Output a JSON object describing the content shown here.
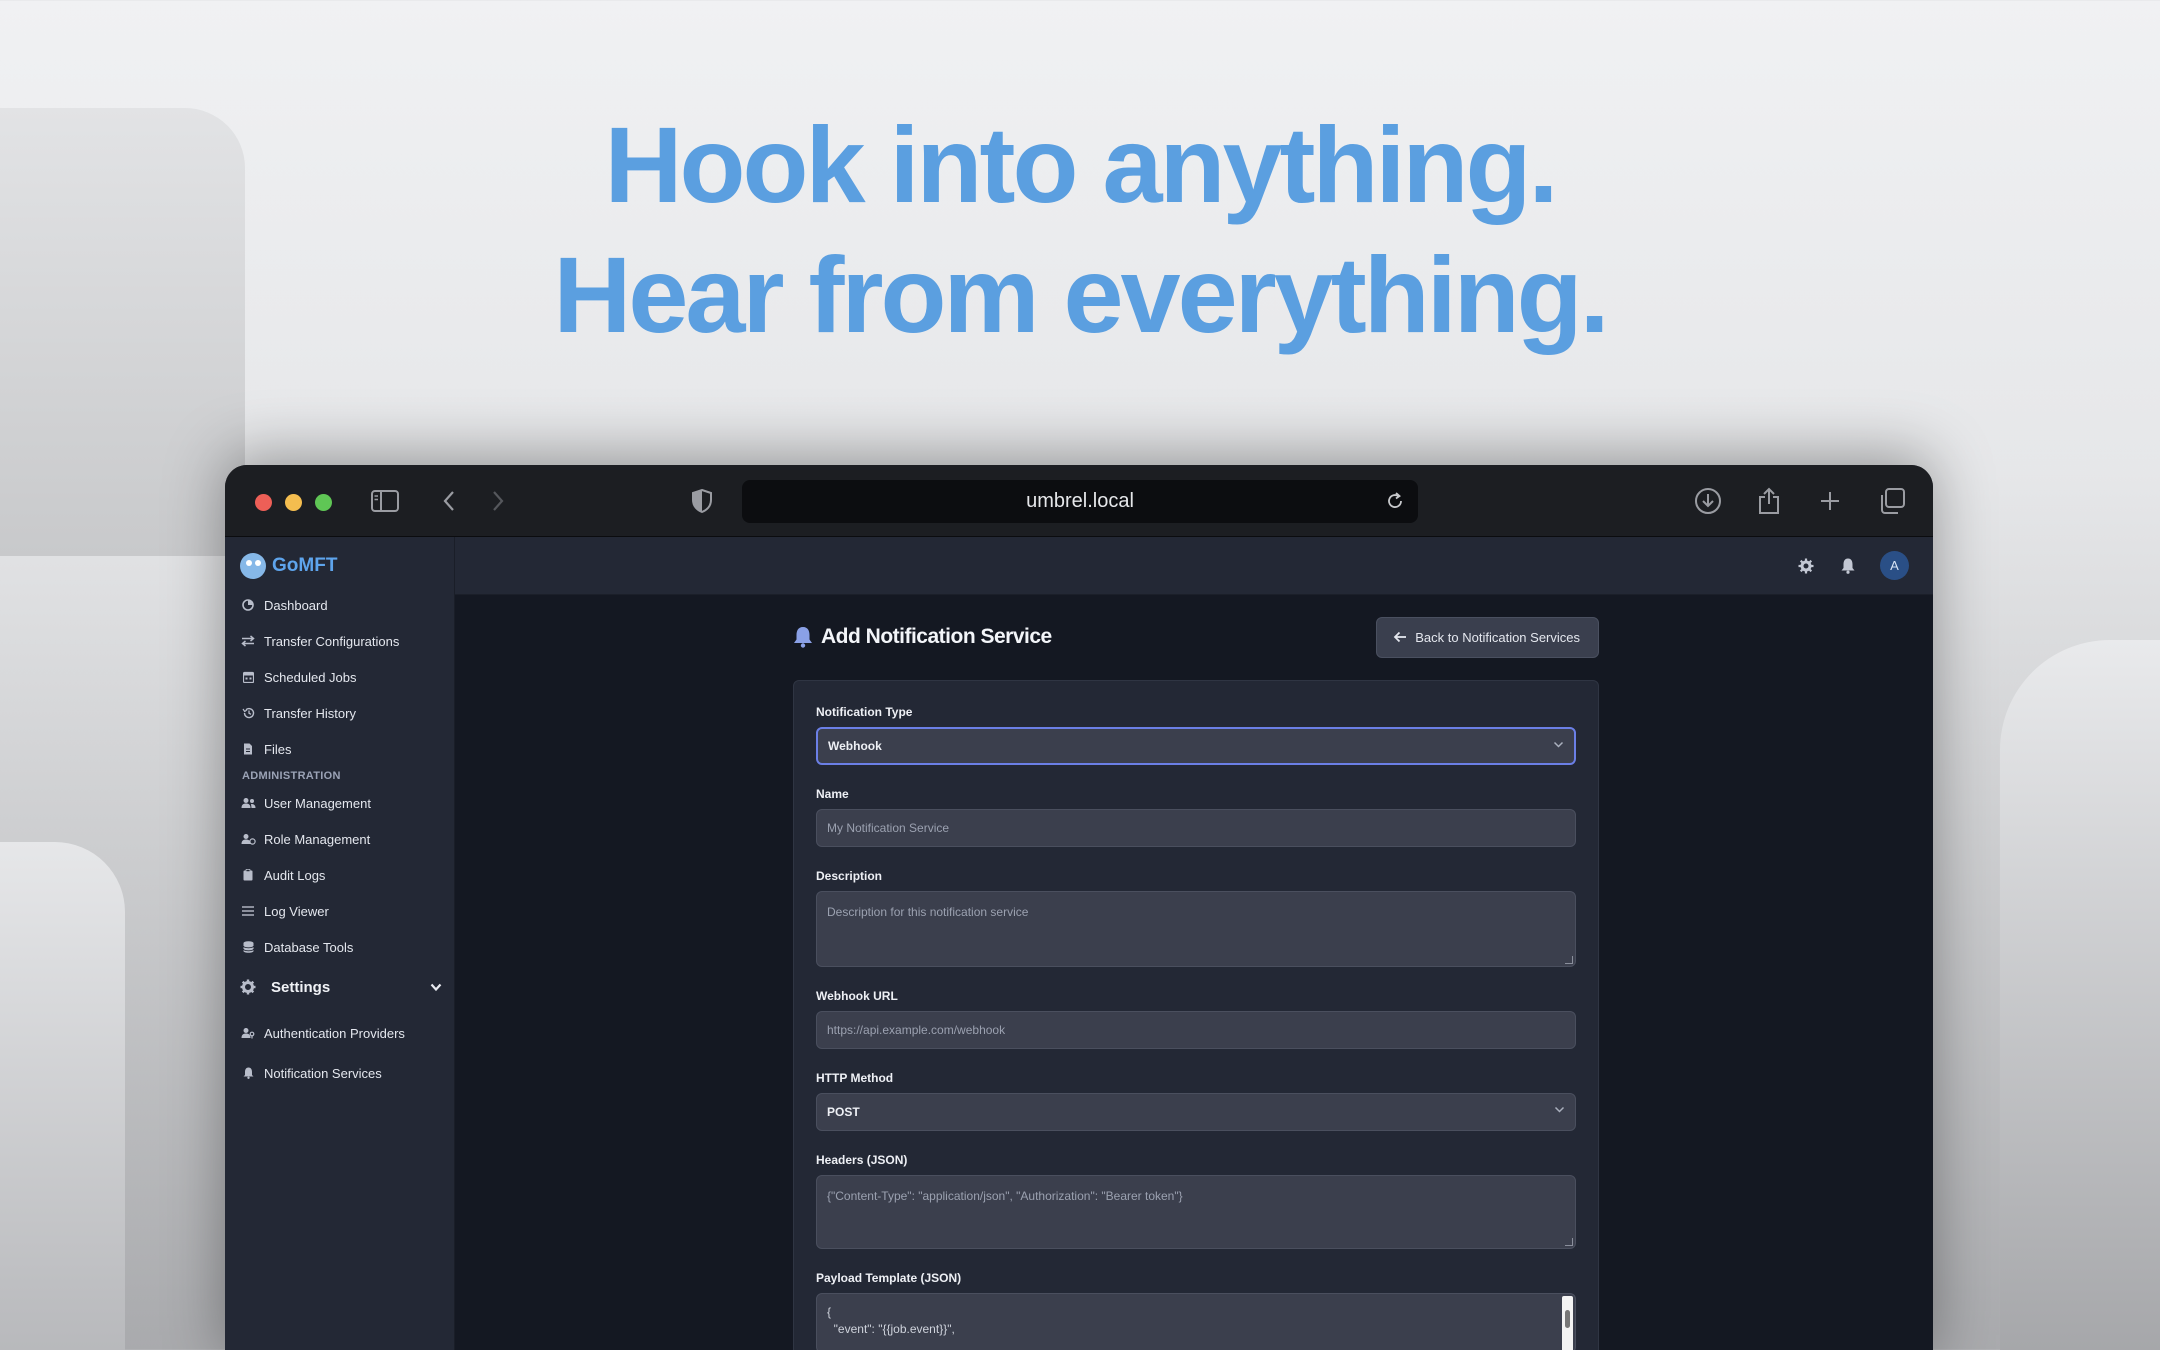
{
  "hero": {
    "line1": "Hook into anything.",
    "line2": "Hear from everything."
  },
  "browser": {
    "url": "umbrel.local",
    "icons": [
      "sidebar-toggle-icon",
      "back-icon",
      "forward-icon",
      "shield-icon",
      "reload-icon",
      "download-icon",
      "share-icon",
      "new-tab-icon",
      "tab-overview-icon"
    ]
  },
  "app": {
    "name": "GoMFT",
    "sidebar": {
      "items": [
        {
          "label": "Dashboard",
          "icon": "dashboard-icon"
        },
        {
          "label": "Transfer Configurations",
          "icon": "transfer-icon"
        },
        {
          "label": "Scheduled Jobs",
          "icon": "calendar-icon"
        },
        {
          "label": "Transfer History",
          "icon": "history-icon"
        },
        {
          "label": "Files",
          "icon": "file-icon"
        }
      ],
      "admin_heading": "ADMINISTRATION",
      "admin_items": [
        {
          "label": "User Management",
          "icon": "users-icon"
        },
        {
          "label": "Role Management",
          "icon": "role-icon"
        },
        {
          "label": "Audit Logs",
          "icon": "clipboard-icon"
        },
        {
          "label": "Log Viewer",
          "icon": "list-icon"
        },
        {
          "label": "Database Tools",
          "icon": "database-icon"
        }
      ],
      "settings_label": "Settings",
      "settings_items": [
        {
          "label": "Authentication Providers",
          "icon": "users-key-icon"
        },
        {
          "label": "Notification Services",
          "icon": "bell-icon"
        }
      ]
    },
    "topbar": {
      "avatar_initial": "A"
    },
    "page": {
      "title": "Add Notification Service",
      "back_button": "Back to Notification Services"
    },
    "form": {
      "type_label": "Notification Type",
      "type_value": "Webhook",
      "name_label": "Name",
      "name_placeholder": "My Notification Service",
      "description_label": "Description",
      "description_placeholder": "Description for this notification service",
      "url_label": "Webhook URL",
      "url_placeholder": "https://api.example.com/webhook",
      "method_label": "HTTP Method",
      "method_value": "POST",
      "headers_label": "Headers (JSON)",
      "headers_placeholder": "{\"Content-Type\": \"application/json\", \"Authorization\": \"Bearer token\"}",
      "payload_label": "Payload Template (JSON)",
      "payload_line1": "{",
      "payload_line2": "  \"event\": \"{{job.event}}\","
    },
    "colors": {
      "hero": "#5b9fe0",
      "accent_focus": "#6b7fe6",
      "sidebar_bg": "#232835",
      "main_bg": "#141822"
    }
  }
}
